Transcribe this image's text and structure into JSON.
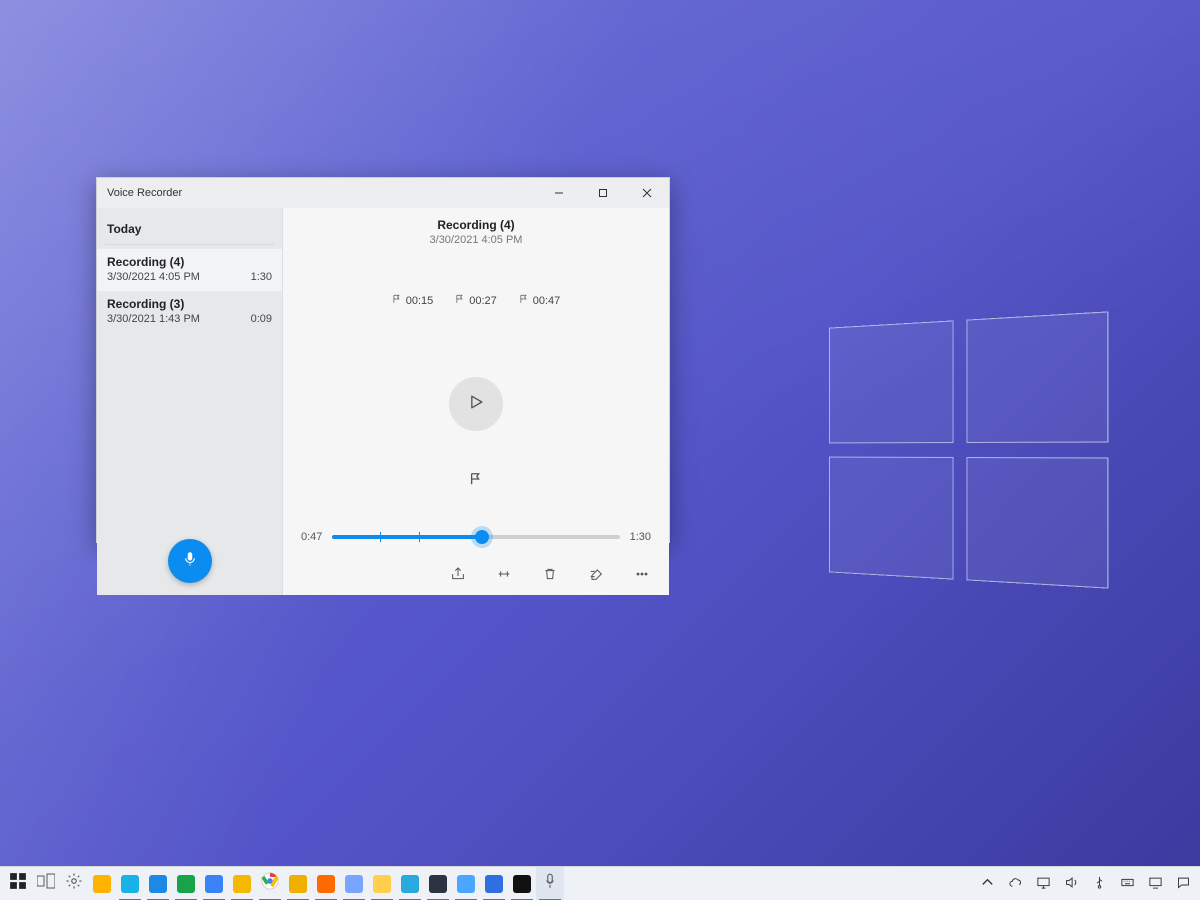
{
  "app": {
    "title": "Voice Recorder"
  },
  "sidebar": {
    "heading": "Today",
    "recordings": [
      {
        "name": "Recording (4)",
        "datetime": "3/30/2021 4:05 PM",
        "duration": "1:30"
      },
      {
        "name": "Recording (3)",
        "datetime": "3/30/2021 1:43 PM",
        "duration": "0:09"
      }
    ]
  },
  "detail": {
    "title": "Recording (4)",
    "datetime": "3/30/2021 4:05 PM",
    "markers": [
      "00:15",
      "00:27",
      "00:47"
    ],
    "current_time": "0:47",
    "total_time": "1:30",
    "progress_fraction": 0.52,
    "marker_fractions": [
      0.167,
      0.3,
      0.522
    ]
  },
  "taskbar": {
    "items": [
      {
        "name": "start",
        "color": "#222"
      },
      {
        "name": "task-view",
        "color": "#555"
      },
      {
        "name": "settings",
        "color": "#555"
      },
      {
        "name": "store",
        "color": "#ffb300"
      },
      {
        "name": "notes",
        "color": "#18b2e7"
      },
      {
        "name": "edge",
        "color": "#1e88e5"
      },
      {
        "name": "edge-beta",
        "color": "#16a34a"
      },
      {
        "name": "edge-dev",
        "color": "#3b82f6"
      },
      {
        "name": "edge-canary",
        "color": "#f5b800"
      },
      {
        "name": "chrome",
        "color": "#ffffff"
      },
      {
        "name": "chrome-canary",
        "color": "#f0b000"
      },
      {
        "name": "firefox",
        "color": "#ff6a00"
      },
      {
        "name": "firefox-dev",
        "color": "#7aa5ff"
      },
      {
        "name": "explorer",
        "color": "#ffcf4d"
      },
      {
        "name": "mail",
        "color": "#2aa9e0"
      },
      {
        "name": "terminal",
        "color": "#2b3440"
      },
      {
        "name": "onedrive-alt",
        "color": "#4aa6ff"
      },
      {
        "name": "photos",
        "color": "#2f6fe0"
      },
      {
        "name": "cmd",
        "color": "#111111"
      },
      {
        "name": "voice-recorder",
        "color": "#e6e6e6"
      }
    ],
    "tray_time": ""
  },
  "colors": {
    "accent": "#0a8cf0"
  }
}
